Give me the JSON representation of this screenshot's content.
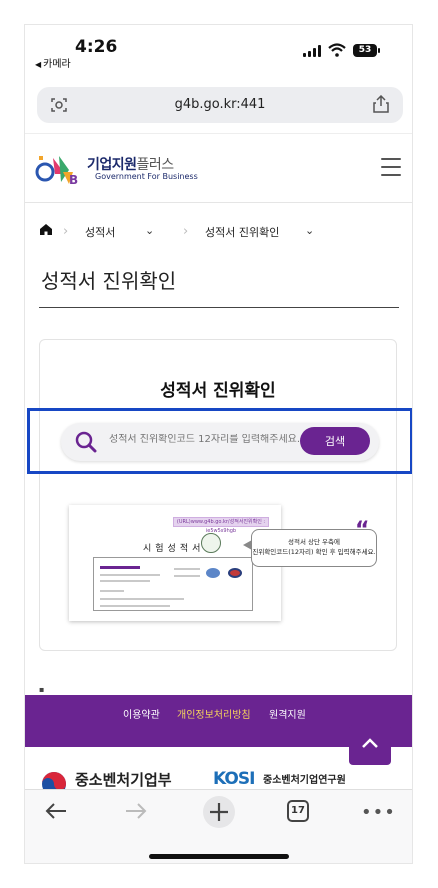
{
  "status_bar": {
    "time": "4:26",
    "back_app": "카메라",
    "battery": "53"
  },
  "address_bar": {
    "url": "g4b.go.kr:441"
  },
  "site": {
    "logo_title": "기업지원",
    "logo_title_suffix": "플러스",
    "logo_subtitle": "Government For Business"
  },
  "breadcrumb": {
    "level1": "성적서",
    "level2": "성적서 진위확인"
  },
  "page_title": "성적서 진위확인",
  "card": {
    "title": "성적서 진위확인",
    "search_placeholder": "성적서 진위확인코드 12자리를 입력해주세요.",
    "search_button": "검색"
  },
  "illustration": {
    "url_box": "(URL)www.g4b.go.kr/성적서진위확인 : ie5w5s9hgb",
    "doc_heading": "시험성적서",
    "tip_line1": "성적서 상단 우측에",
    "tip_line2": "진위확인코드(12자리) 확인 후 입력해주세요."
  },
  "footer": {
    "links": [
      "이용약관",
      "개인정보처리방침",
      "원격지원"
    ]
  },
  "partners": {
    "mss": "중소벤처기업부",
    "kosi_logo": "KOSI",
    "kosi": "중소벤처기업연구원"
  },
  "toolbar": {
    "tabs": "17"
  },
  "colors": {
    "brand_purple": "#6a2491",
    "highlight_blue": "#1747c4",
    "privacy_yellow": "#f6d35d"
  }
}
